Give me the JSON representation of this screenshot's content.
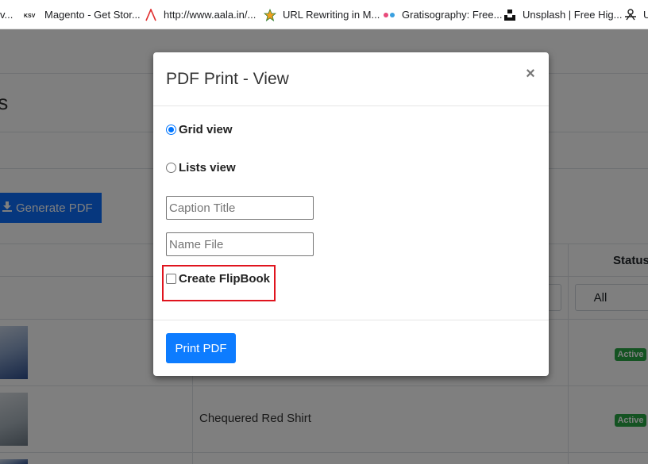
{
  "bookmarks": [
    {
      "label": "v...",
      "icon": "none"
    },
    {
      "label": "Magento - Get Stor...",
      "icon": "ksv-icon"
    },
    {
      "label": "http://www.aala.in/...",
      "icon": "lambda-icon"
    },
    {
      "label": "URL Rewriting in M...",
      "icon": "star-icon"
    },
    {
      "label": "Gratisography: Free...",
      "icon": "dots-icon"
    },
    {
      "label": "Unsplash | Free Hig...",
      "icon": "unsplash-icon"
    },
    {
      "label": "U",
      "icon": "network-icon"
    }
  ],
  "background": {
    "page_title": "ts",
    "generate_pdf_label": "Generate PDF",
    "status_header": "Status",
    "status_filter": "All",
    "rows": [
      {
        "name": "",
        "status": "Active"
      },
      {
        "name": "Chequered Red Shirt",
        "status": "Active"
      }
    ]
  },
  "modal": {
    "title": "PDF Print - View",
    "close_symbol": "×",
    "grid_view_label": "Grid view",
    "grid_view_checked": true,
    "lists_view_label": "Lists view",
    "lists_view_checked": false,
    "caption_placeholder": "Caption Title",
    "caption_value": "",
    "name_file_placeholder": "Name File",
    "name_file_value": "",
    "flipbook_label": "Create FlipBook",
    "flipbook_checked": false,
    "print_button_label": "Print PDF"
  },
  "colors": {
    "primary": "#0d7cff",
    "highlight": "#e0141e",
    "badge_active": "#28a745"
  }
}
